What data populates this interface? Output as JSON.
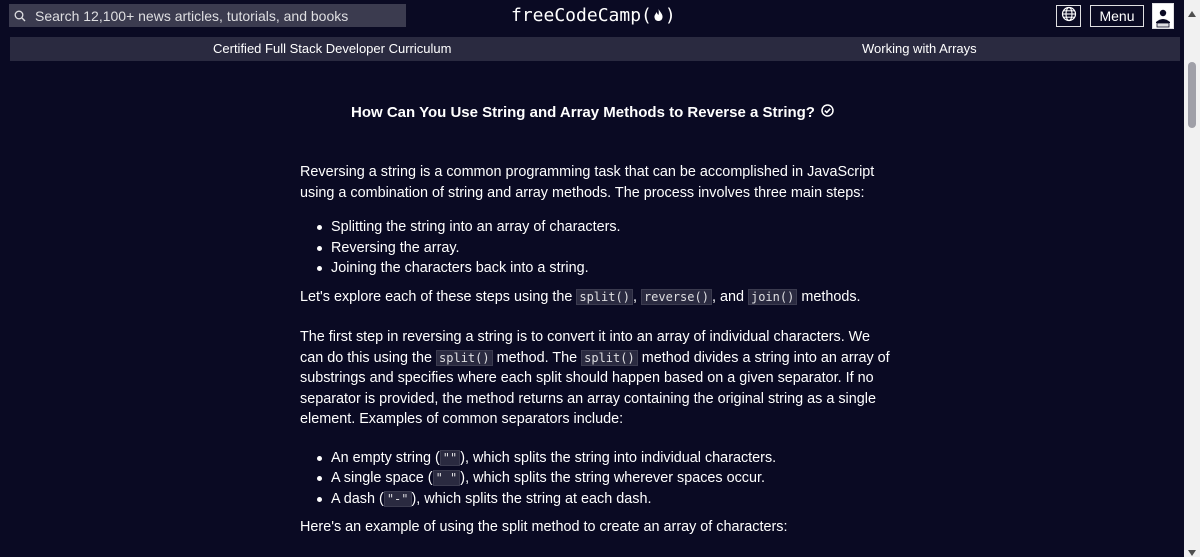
{
  "navbar": {
    "search_placeholder": "Search 12,100+ news articles, tutorials, and books",
    "logo_left": "freeCodeCamp(",
    "logo_right": ")",
    "menu_label": "Menu"
  },
  "subnav": {
    "curriculum": "Certified Full Stack Developer Curriculum",
    "module": "Working with Arrays"
  },
  "lesson": {
    "title": "How Can You Use String and Array Methods to Reverse a String?",
    "intro": "Reversing a string is a common programming task that can be accomplished in JavaScript using a combination of string and array methods. The process involves three main steps:",
    "steps": [
      "Splitting the string into an array of characters.",
      "Reversing the array.",
      "Joining the characters back into a string."
    ],
    "explore_before": "Let's explore each of these steps using the ",
    "explore_code1": "split()",
    "explore_sep1": ", ",
    "explore_code2": "reverse()",
    "explore_sep2": ", and ",
    "explore_code3": "join()",
    "explore_after": " methods.",
    "p2_a": "The first step in reversing a string is to convert it into an array of individual characters. We can do this using the ",
    "p2_code1": "split()",
    "p2_b": " method. The ",
    "p2_code2": "split()",
    "p2_c": " method divides a string into an array of substrings and specifies where each split should happen based on a given separator. If no separator is provided, the method returns an array containing the original string as a single element. Examples of common separators include:",
    "separators": [
      {
        "before": "An empty string (",
        "code": "\"\"",
        "after": "), which splits the string into individual characters."
      },
      {
        "before": "A single space (",
        "code": "\" \"",
        "after": "), which splits the string wherever spaces occur."
      },
      {
        "before": "A dash (",
        "code": "\"-\"",
        "after": "), which splits the string at each dash."
      }
    ],
    "example_intro": "Here's an example of using the split method to create an array of characters:"
  },
  "colors": {
    "background": "#0a0a23",
    "subnav": "#2a2a40",
    "search": "#3b3b4f",
    "text": "#ffffff"
  },
  "icons": [
    "search-icon",
    "flame-icon",
    "globe-icon",
    "avatar-icon",
    "check-circle-icon",
    "scroll-up-arrow",
    "scroll-down-arrow"
  ]
}
